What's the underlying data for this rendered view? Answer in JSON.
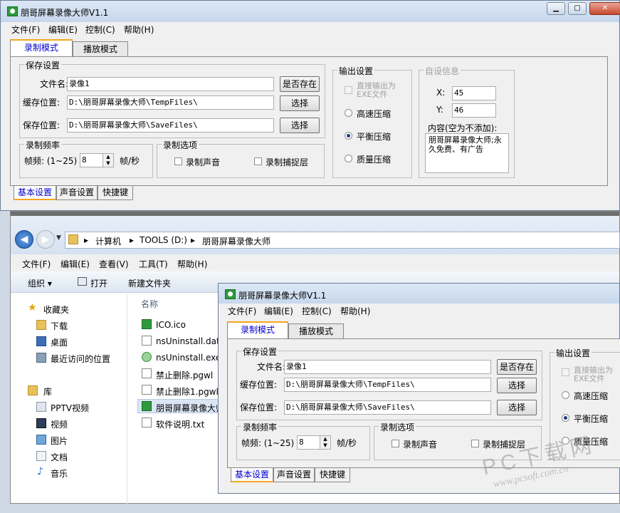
{
  "app": {
    "title": "朋哥屏幕录像大师V1.1",
    "icon": "app-icon",
    "menu": [
      "文件(F)",
      "编辑(E)",
      "控制(C)",
      "帮助(H)"
    ],
    "tabs": [
      "录制模式",
      "播放模式"
    ],
    "save_group": "保存设置",
    "filename_label": "文件名:",
    "filename_value": "录像1",
    "exists_button": "是否存在",
    "cache_label": "缓存位置:",
    "cache_value": "D:\\朋哥屏幕录像大师\\TempFiles\\",
    "choose1": "选择",
    "save_label": "保存位置:",
    "save_value": "D:\\朋哥屏幕录像大师\\SaveFiles\\",
    "choose2": "选择",
    "freq_group": "录制频率",
    "fps_label": "帧频: (1~25)",
    "fps_value": "8",
    "fps_unit": "帧/秒",
    "opt_group": "录制选项",
    "opt_sound": "录制声音",
    "opt_layer": "录制捕捉层",
    "out_group": "输出设置",
    "out_exe": "直接输出为EXE文件",
    "out_fast": "高速压缩",
    "out_balance": "平衡压缩",
    "out_quality": "质量压缩",
    "info_group": "自设信息",
    "x_label": "X:",
    "x_value": "45",
    "y_label": "Y:",
    "y_value": "46",
    "content_label": "内容(空为不添加):",
    "content_value": "朋哥屏幕录像大师;永久免费、有广告",
    "bottom_tabs": [
      "基本设置",
      "声音设置",
      "快捷键"
    ]
  },
  "explorer": {
    "path": [
      "计算机",
      "TOOLS (D:)",
      "朋哥屏幕录像大师"
    ],
    "menu": [
      "文件(F)",
      "编辑(E)",
      "查看(V)",
      "工具(T)",
      "帮助(H)"
    ],
    "toolbar": [
      "组织 ▾",
      "打开",
      "新建文件夹"
    ],
    "nav": {
      "favorites": "收藏夹",
      "fav_items": [
        "下载",
        "桌面",
        "最近访问的位置"
      ],
      "library": "库",
      "lib_items": [
        "PPTV视频",
        "视频",
        "图片",
        "文档",
        "音乐"
      ]
    },
    "col_name": "名称",
    "files": [
      "ICO.ico",
      "nsUninstall.dat",
      "nsUninstall.exe",
      "禁止删除.pgwl",
      "禁止删除1.pgwl",
      "朋哥屏幕录像大师",
      "软件说明.txt"
    ]
  },
  "app2": {
    "out_exe_partial": "直接输出为",
    "out_exe2": "EXE文件"
  },
  "watermark": {
    "line1": "PC下载网",
    "line2": "www.pcsoft.com.cn"
  }
}
